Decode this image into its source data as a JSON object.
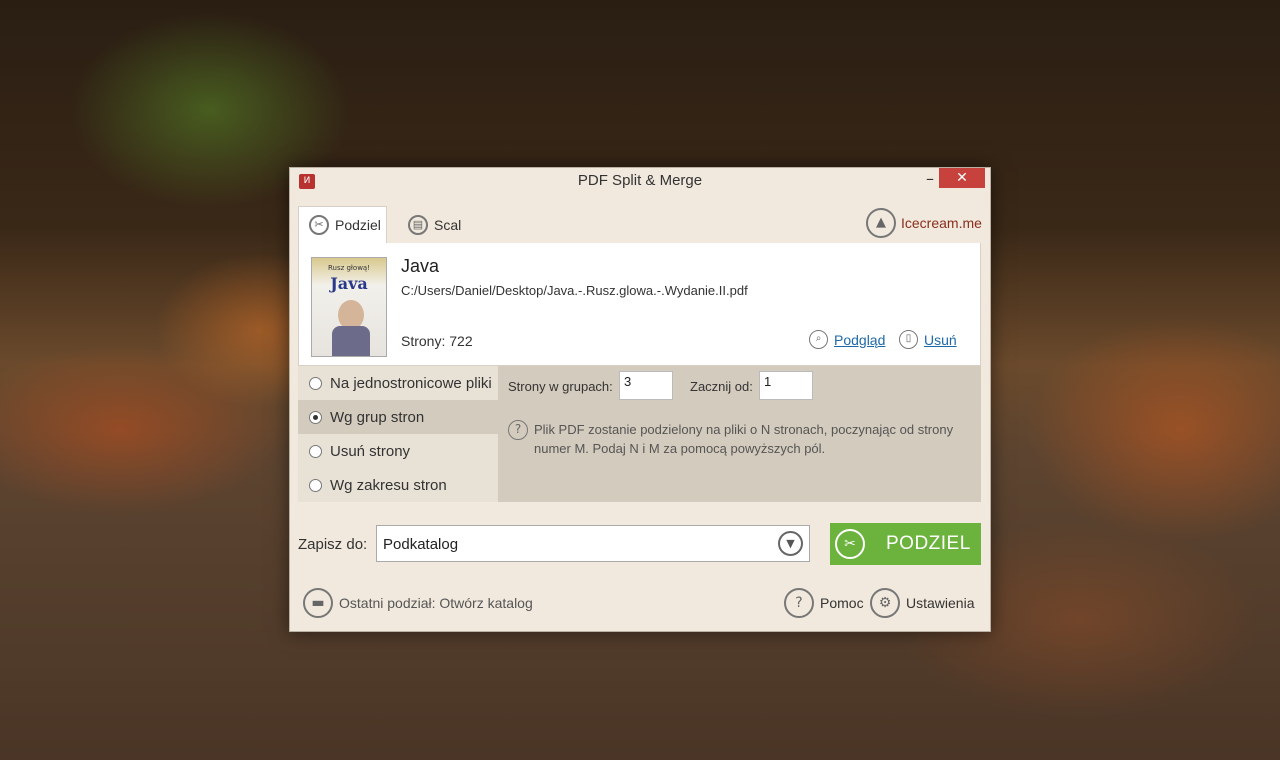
{
  "window": {
    "title": "PDF Split & Merge",
    "logo_text": "И",
    "minimize_glyph": "–",
    "close_glyph": "✕"
  },
  "tabs": [
    {
      "label": "Podziel",
      "icon": "scissors-icon",
      "glyph": "✂",
      "active": true
    },
    {
      "label": "Scal",
      "icon": "merge-icon",
      "glyph": "▤",
      "active": false
    }
  ],
  "brand": {
    "label": "Icecream.me",
    "icon": "icecream-icon",
    "glyph": "▲"
  },
  "file": {
    "name": "Java",
    "path": "C:/Users/Daniel/Desktop/Java.-.Rusz.glowa.-.Wydanie.II.pdf",
    "pages_label": "Strony: 722",
    "cover": {
      "top_text": "Rusz głową!",
      "title_text": "Java"
    },
    "preview_label": "Podgląd",
    "preview_glyph": "⌕",
    "remove_label": "Usuń",
    "remove_glyph": "▯"
  },
  "modes": [
    {
      "label": "Na jednostronicowe pliki",
      "selected": false
    },
    {
      "label": "Wg grup stron",
      "selected": true
    },
    {
      "label": "Usuń strony",
      "selected": false
    },
    {
      "label": "Wg zakresu stron",
      "selected": false
    }
  ],
  "options": {
    "group_label": "Strony w grupach:",
    "group_value": "3",
    "start_label": "Zacznij od:",
    "start_value": "1",
    "help_glyph": "?",
    "help_text": "Plik PDF zostanie podzielony na pliki o N stronach, poczynając od strony numer M. Podaj N i M za pomocą powyższych pól."
  },
  "save": {
    "label": "Zapisz do:",
    "value": "Podkatalog",
    "arrow_glyph": "▼"
  },
  "split_button": {
    "label": "PODZIEL",
    "glyph": "✂",
    "color": "#6cb33d"
  },
  "footer": {
    "last_split": "Ostatni podział: Otwórz katalog",
    "folder_glyph": "▬",
    "help": "Pomoc",
    "help_glyph": "?",
    "settings": "Ustawienia",
    "settings_glyph": "⚙"
  }
}
